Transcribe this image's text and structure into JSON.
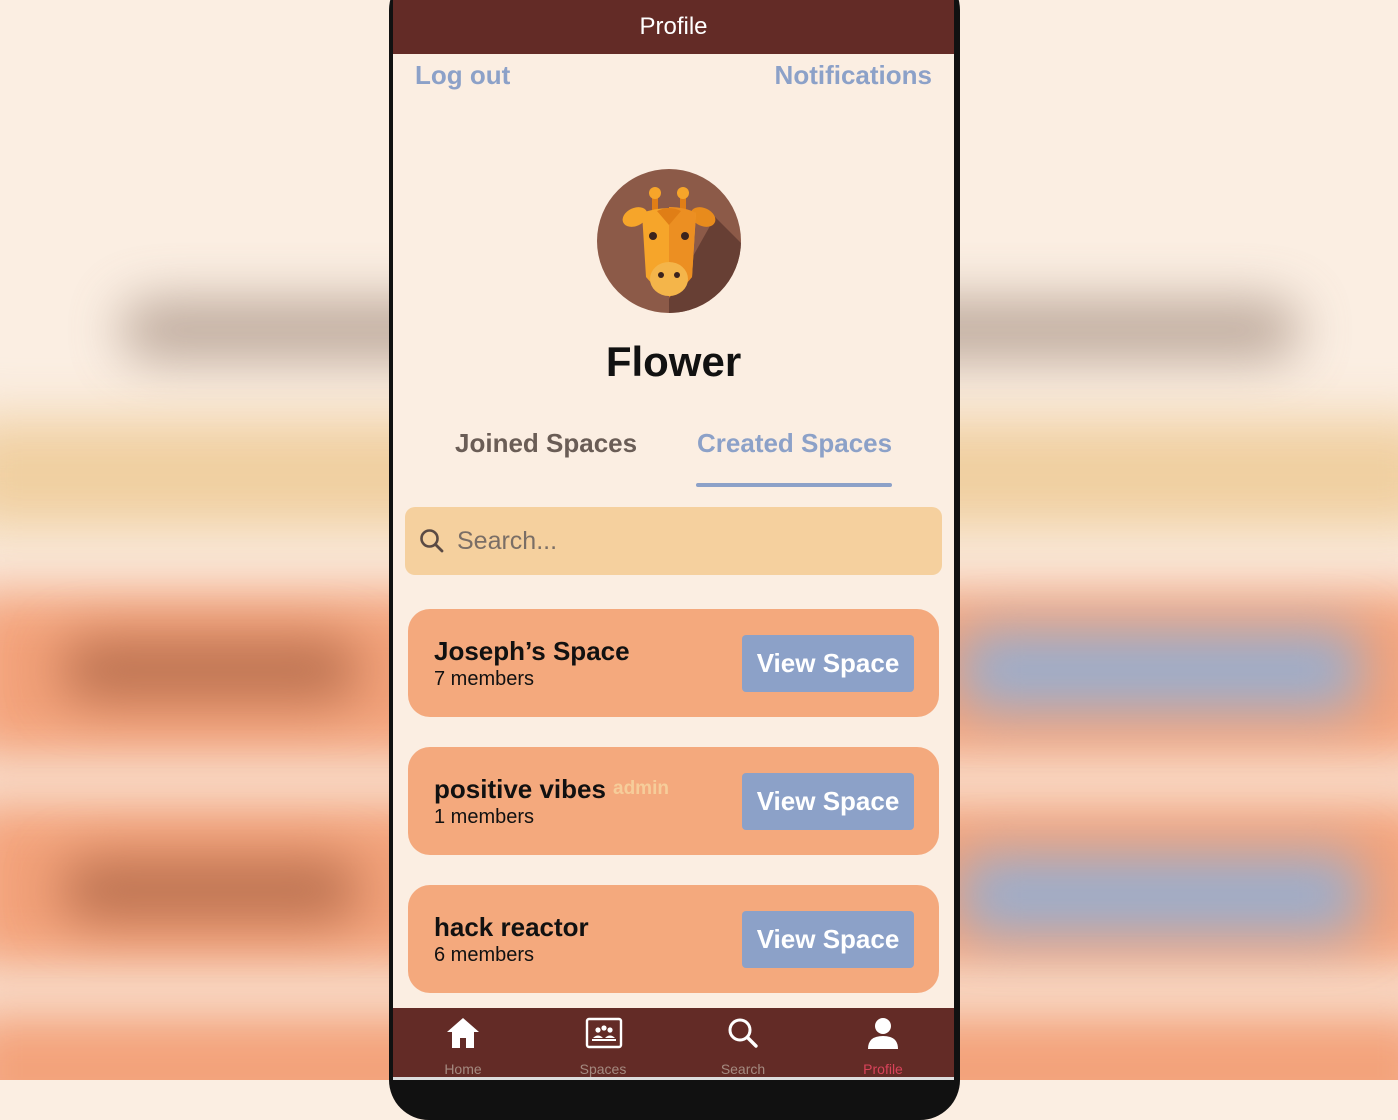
{
  "header": {
    "title": "Profile"
  },
  "top_links": {
    "logout": "Log out",
    "notifications": "Notifications"
  },
  "profile": {
    "name": "Flower",
    "avatar_icon": "giraffe-icon"
  },
  "tabs": [
    {
      "label": "Joined Spaces",
      "active": false
    },
    {
      "label": "Created Spaces",
      "active": true
    }
  ],
  "search": {
    "placeholder": "Search...",
    "value": ""
  },
  "spaces": [
    {
      "name": "Joseph’s Space",
      "members": "7 members",
      "badge": "",
      "action": "View Space"
    },
    {
      "name": "positive vibes",
      "members": "1 members",
      "badge": "admin",
      "action": "View Space"
    },
    {
      "name": "hack reactor",
      "members": "6 members",
      "badge": "",
      "action": "View Space"
    }
  ],
  "nav": [
    {
      "label": "Home",
      "icon": "home-icon",
      "active": false
    },
    {
      "label": "Spaces",
      "icon": "spaces-icon",
      "active": false
    },
    {
      "label": "Search",
      "icon": "search-icon",
      "active": false
    },
    {
      "label": "Profile",
      "icon": "person-icon",
      "active": true
    }
  ],
  "colors": {
    "header_bg": "#632b26",
    "page_bg": "#fbeee2",
    "accent_blue": "#8ca1c8",
    "card_bg": "#f4a97d",
    "search_bg": "#f5d09e",
    "active_nav": "#d9435a"
  }
}
